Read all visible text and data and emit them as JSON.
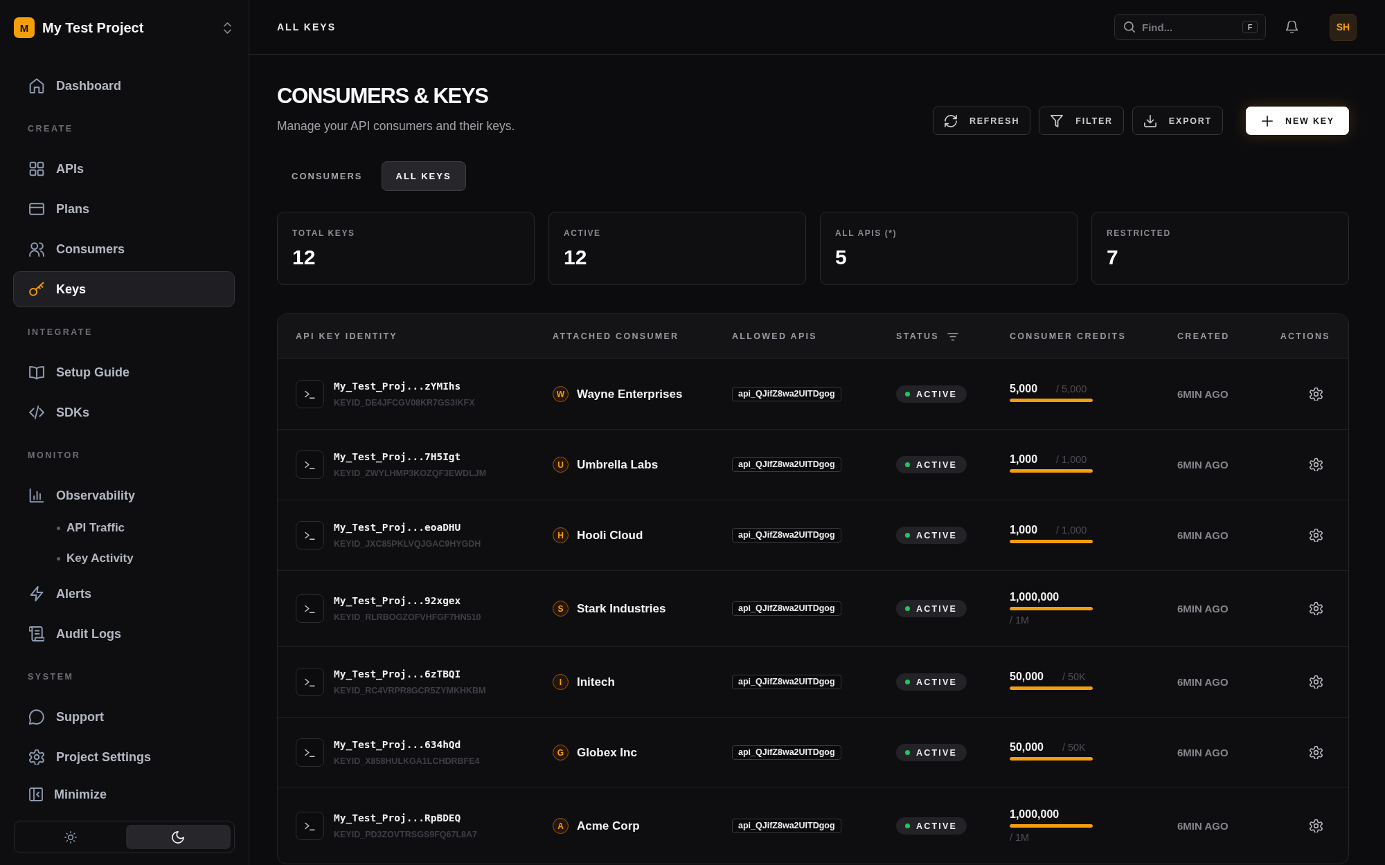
{
  "sidebar": {
    "project": {
      "initial": "M",
      "name": "My Test Project"
    },
    "groups": [
      {
        "items": [
          {
            "label": "Dashboard",
            "selected": false
          }
        ]
      },
      {
        "heading": "CREATE",
        "items": [
          {
            "label": "APIs",
            "selected": false
          },
          {
            "label": "Plans",
            "selected": false
          },
          {
            "label": "Consumers",
            "selected": false
          },
          {
            "label": "Keys",
            "selected": true
          }
        ]
      },
      {
        "heading": "INTEGRATE",
        "items": [
          {
            "label": "Setup Guide",
            "selected": false
          },
          {
            "label": "SDKs",
            "selected": false
          }
        ]
      },
      {
        "heading": "MONITOR",
        "items": [
          {
            "label": "Observability",
            "selected": false,
            "children": [
              {
                "label": "API Traffic",
                "selected": false
              },
              {
                "label": "Key Activity",
                "selected": false
              }
            ]
          },
          {
            "label": "Alerts",
            "selected": false
          },
          {
            "label": "Audit Logs",
            "selected": false
          }
        ]
      },
      {
        "heading": "SYSTEM",
        "items": [
          {
            "label": "Support",
            "selected": false
          },
          {
            "label": "Project Settings",
            "selected": false
          }
        ]
      }
    ],
    "minimize": "Minimize",
    "theme_toggle": [
      {
        "kind": "light",
        "selected": false
      },
      {
        "kind": "dark",
        "selected": true
      }
    ]
  },
  "top_bar": {
    "title": "ALL KEYS",
    "search": {
      "placeholder": "Find...",
      "shortcut": "F"
    },
    "avatar": "SH"
  },
  "page": {
    "title": "CONSUMERS & KEYS",
    "subtitle": "Manage your API consumers and their keys.",
    "actions": [
      {
        "kind": "refresh",
        "label": "REFRESH"
      },
      {
        "kind": "filter",
        "label": "FILTER"
      },
      {
        "kind": "export",
        "label": "EXPORT"
      },
      {
        "kind": "create",
        "label": "NEW KEY"
      }
    ],
    "tabs": [
      {
        "label": "CONSUMERS",
        "selected": false
      },
      {
        "label": "ALL KEYS",
        "selected": true
      }
    ],
    "stats": [
      {
        "label": "TOTAL KEYS",
        "value": "12"
      },
      {
        "label": "ACTIVE",
        "value": "12"
      },
      {
        "label": "ALL APIS (*)",
        "value": "5"
      },
      {
        "label": "RESTRICTED",
        "value": "7"
      }
    ]
  },
  "table": {
    "columns": [
      {
        "label": "API KEY IDENTITY",
        "filterable": false
      },
      {
        "label": "ATTACHED CONSUMER",
        "filterable": false
      },
      {
        "label": "ALLOWED APIS",
        "filterable": false
      },
      {
        "label": "STATUS",
        "filterable": true
      },
      {
        "label": "CONSUMER CREDITS",
        "filterable": false
      },
      {
        "label": "CREATED",
        "filterable": false
      },
      {
        "label": "ACTIONS",
        "filterable": false
      }
    ],
    "rows": [
      {
        "key_name": "My_Test_Proj...zYMIhs",
        "key_id": "KEYID_DE4JFCGV08KR7GS3IKFX",
        "consumer_initial": "W",
        "consumer": "Wayne Enterprises",
        "api": "api_QJifZ8wa2UITDgog",
        "status": "ACTIVE",
        "credits": "5,000",
        "limit": "/ 5,000",
        "level": 1,
        "created": "6MIN AGO"
      },
      {
        "key_name": "My_Test_Proj...7H5Igt",
        "key_id": "KEYID_ZWYLHMP3KOZQF3EWDLJM",
        "consumer_initial": "U",
        "consumer": "Umbrella Labs",
        "api": "api_QJifZ8wa2UITDgog",
        "status": "ACTIVE",
        "credits": "1,000",
        "limit": "/ 1,000",
        "level": 1,
        "created": "6MIN AGO"
      },
      {
        "key_name": "My_Test_Proj...eoaDHU",
        "key_id": "KEYID_JXC85PKLVQJGAC9HYGDH",
        "consumer_initial": "H",
        "consumer": "Hooli Cloud",
        "api": "api_QJifZ8wa2UITDgog",
        "status": "ACTIVE",
        "credits": "1,000",
        "limit": "/ 1,000",
        "level": 1,
        "created": "6MIN AGO"
      },
      {
        "key_name": "My_Test_Proj...92xgex",
        "key_id": "KEYID_RLRBOGZOFVHFGF7HN510",
        "consumer_initial": "S",
        "consumer": "Stark Industries",
        "api": "api_QJifZ8wa2UITDgog",
        "status": "ACTIVE",
        "credits": "1,000,000",
        "limit": "/ 1M",
        "level": 1,
        "created": "6MIN AGO"
      },
      {
        "key_name": "My_Test_Proj...6zTBQI",
        "key_id": "KEYID_RC4VRPR8GCR5ZYMKHKBM",
        "consumer_initial": "I",
        "consumer": "Initech",
        "api": "api_QJifZ8wa2UITDgog",
        "status": "ACTIVE",
        "credits": "50,000",
        "limit": "/ 50K",
        "level": 1,
        "created": "6MIN AGO"
      },
      {
        "key_name": "My_Test_Proj...634hQd",
        "key_id": "KEYID_X858HULKGA1LCHDRBFE4",
        "consumer_initial": "G",
        "consumer": "Globex Inc",
        "api": "api_QJifZ8wa2UITDgog",
        "status": "ACTIVE",
        "credits": "50,000",
        "limit": "/ 50K",
        "level": 1,
        "created": "6MIN AGO"
      },
      {
        "key_name": "My_Test_Proj...RpBDEQ",
        "key_id": "KEYID_PD3ZOVTRSGS9FQ67L8A7",
        "consumer_initial": "A",
        "consumer": "Acme Corp",
        "api": "api_QJifZ8wa2UITDgog",
        "status": "ACTIVE",
        "credits": "1,000,000",
        "limit": "/ 1M",
        "level": 1,
        "created": "6MIN AGO"
      }
    ]
  }
}
